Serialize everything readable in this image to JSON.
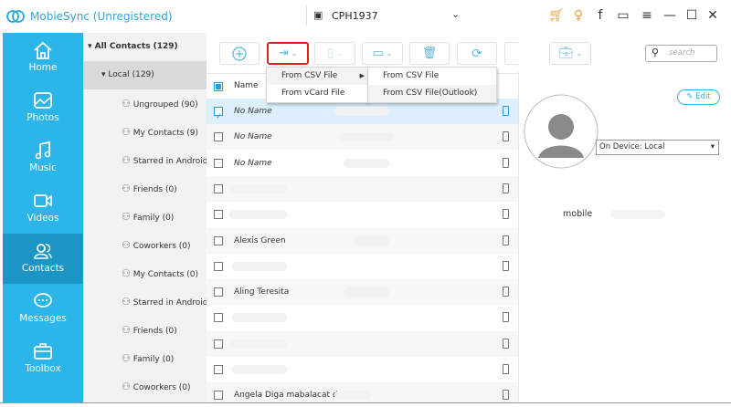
{
  "app": {
    "title": "MobieSync (Unregistered)",
    "device": "CPH1937"
  },
  "titlebar_icons": [
    "cart-icon",
    "key-icon",
    "facebook-icon",
    "feedback-icon",
    "menu-icon",
    "minimize-icon",
    "maximize-icon",
    "close-icon"
  ],
  "sidebar": {
    "items": [
      {
        "label": "Home",
        "icon": "home-icon"
      },
      {
        "label": "Photos",
        "icon": "photos-icon"
      },
      {
        "label": "Music",
        "icon": "music-icon"
      },
      {
        "label": "Videos",
        "icon": "videos-icon"
      },
      {
        "label": "Contacts",
        "icon": "contacts-icon",
        "selected": true
      },
      {
        "label": "Messages",
        "icon": "messages-icon"
      },
      {
        "label": "Toolbox",
        "icon": "toolbox-icon"
      }
    ]
  },
  "groups": {
    "all": "All Contacts",
    "all_count": "(129)",
    "local": "Local",
    "local_count": "(129)",
    "items": [
      "Ungrouped  (90)",
      "My Contacts  (9)",
      "Starred in Android",
      "Friends  (0)",
      "Family  (0)",
      "Coworkers  (0)",
      "My Contacts  (0)",
      "Starred in Android",
      "Friends  (0)",
      "Family  (0)",
      "Coworkers  (0)"
    ]
  },
  "toolbar": {
    "search_placeholder": "search"
  },
  "import_menu": {
    "items": [
      "From CSV File",
      "From vCard File"
    ],
    "submenu": [
      "From CSV File",
      "From CSV File(Outlook)"
    ]
  },
  "list": {
    "header": "Name",
    "rows": [
      "No Name",
      "No Name",
      "No Name",
      "",
      "",
      "Alexis Green",
      "",
      "Aling Teresita",
      "",
      "",
      "",
      "Angela Diga mabalacat d..."
    ]
  },
  "detail": {
    "edit": "Edit",
    "device_select": "On Device: Local",
    "field_label": "mobile"
  },
  "colors": {
    "accent": "#2cb5e9",
    "selected_nav": "#1b94c6",
    "highlight": "#e02020"
  }
}
